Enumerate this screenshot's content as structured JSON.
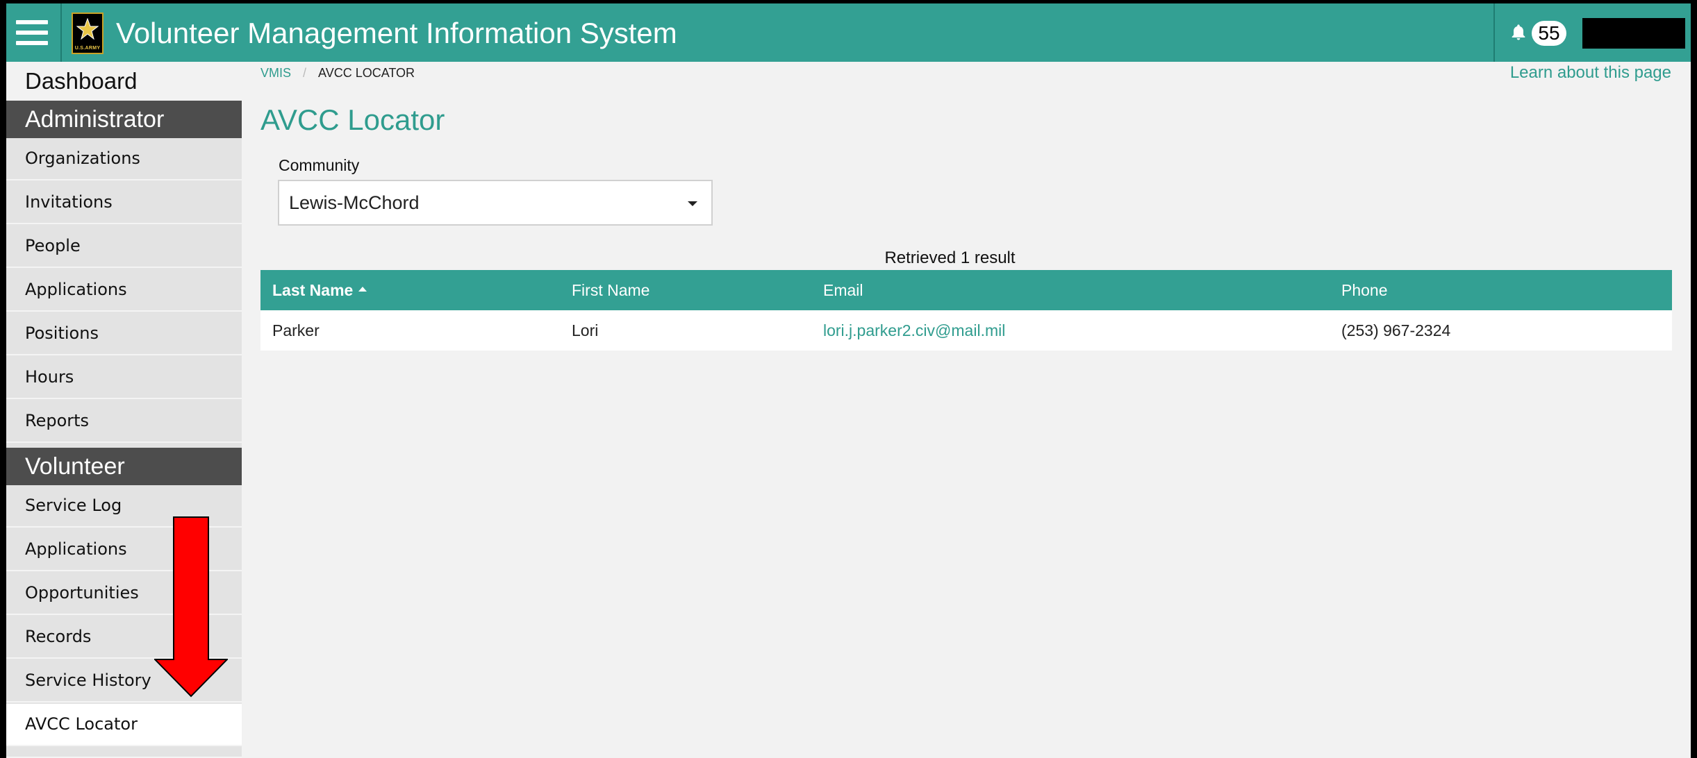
{
  "header": {
    "title": "Volunteer Management Information System",
    "logo_text": "U.S.ARMY",
    "notification_count": "55",
    "accent_color": "#33a093"
  },
  "sidebar": {
    "dashboard_label": "Dashboard",
    "sections": [
      {
        "title": "Administrator",
        "items": [
          "Organizations",
          "Invitations",
          "People",
          "Applications",
          "Positions",
          "Hours",
          "Reports"
        ]
      },
      {
        "title": "Volunteer",
        "items": [
          "Service Log",
          "Applications",
          "Opportunities",
          "Records",
          "Service History",
          "AVCC Locator"
        ]
      }
    ],
    "active_item": "AVCC Locator"
  },
  "breadcrumb": {
    "root": "VMIS",
    "separator": "/",
    "current": "AVCC LOCATOR"
  },
  "learn_link": "Learn about this page",
  "page_title": "AVCC Locator",
  "filter": {
    "label": "Community",
    "value": "Lewis-McChord"
  },
  "results": {
    "count_text": "Retrieved 1 result",
    "columns": [
      "Last Name",
      "First Name",
      "Email",
      "Phone"
    ],
    "sorted_column": "Last Name",
    "rows": [
      [
        "Parker",
        "Lori",
        "lori.j.parker2.civ@mail.mil",
        "(253) 967-2324"
      ]
    ]
  },
  "annotation": {
    "arrow_color": "#ff0000"
  }
}
